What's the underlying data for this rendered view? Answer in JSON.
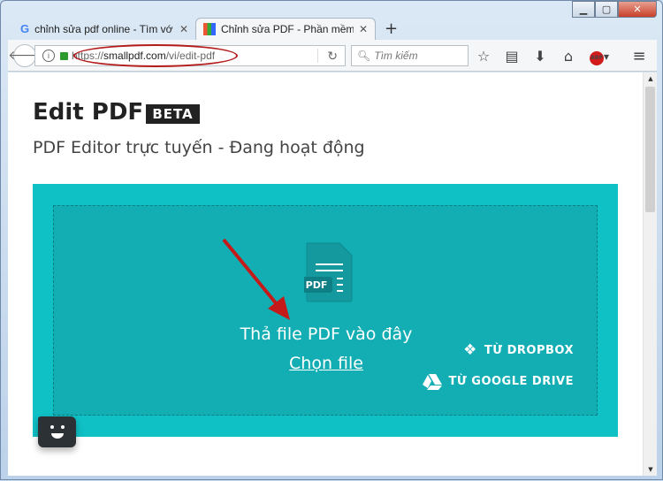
{
  "browser": {
    "tabs": [
      {
        "title": "chỉnh sửa pdf online - Tìm vớ",
        "icon": "google-icon",
        "active": false
      },
      {
        "title": "Chỉnh sửa PDF - Phần mềm c",
        "icon": "smallpdf-icon",
        "active": true
      }
    ],
    "url_prefix": "https://",
    "url_host": "smallpdf.com",
    "url_path": "/vi/edit-pdf",
    "search_placeholder": "Tìm kiếm",
    "toolbar_icons": [
      "star-icon",
      "reading-list-icon",
      "download-icon",
      "home-icon",
      "adblock-icon",
      "menu-icon"
    ],
    "abp_label": "ABP"
  },
  "page": {
    "title": "Edit PDF",
    "badge": "BETA",
    "subtitle": "PDF Editor trực tuyến - Đang hoạt động",
    "file_icon_label": "PDF",
    "drop_text": "Thả file PDF vào đây",
    "choose_file": "Chọn file",
    "dropbox": "TỪ DROPBOX",
    "google_drive": "TỪ GOOGLE DRIVE"
  },
  "colors": {
    "drop_outer": "#0fc0c5",
    "drop_inner": "#12aeb4",
    "annotation": "#c41a1a"
  }
}
